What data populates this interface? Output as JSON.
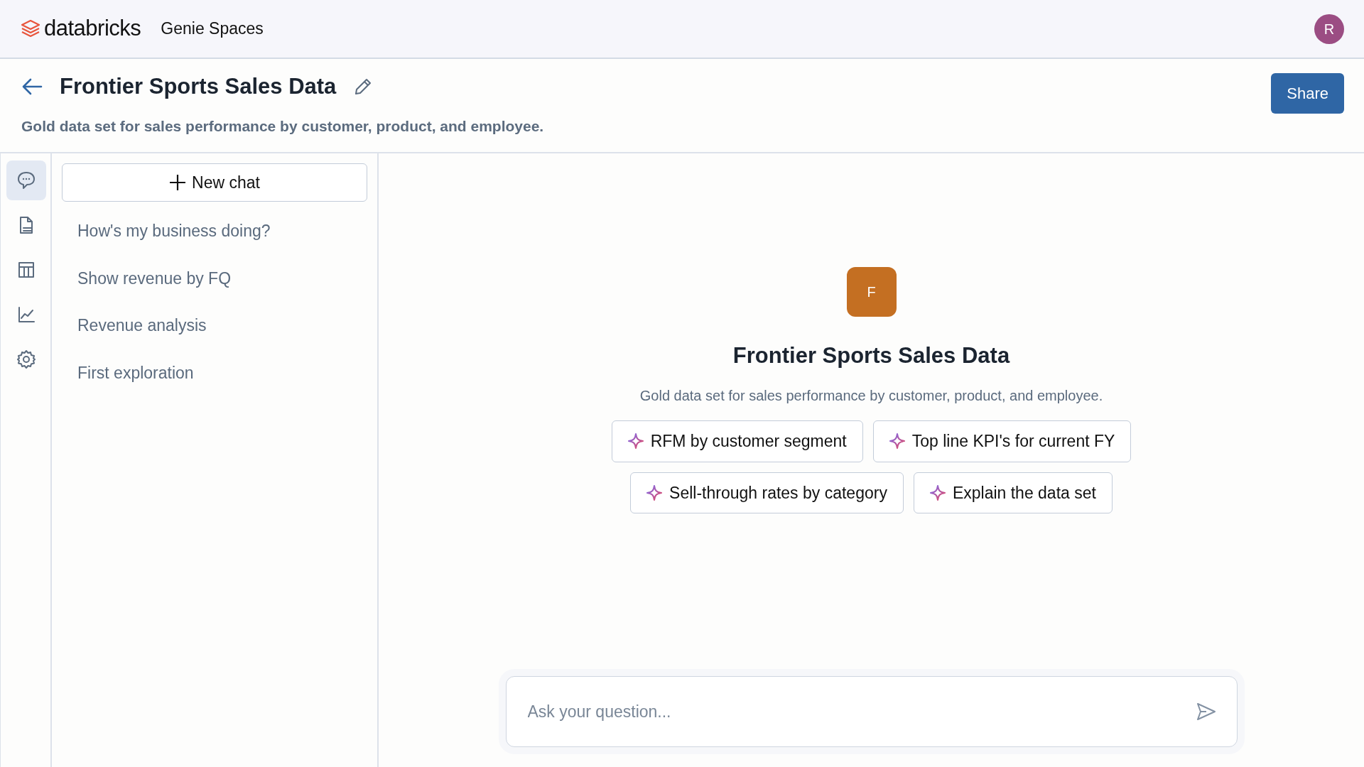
{
  "topbar": {
    "brand": "databricks",
    "product": "Genie Spaces",
    "avatar": "R"
  },
  "space": {
    "title": "Frontier Sports Sales Data",
    "description": "Gold data set for sales performance by customer, product, and employee.",
    "share": "Share"
  },
  "rail": [
    {
      "kind": "chat",
      "selected": true
    },
    {
      "kind": "document",
      "selected": false
    },
    {
      "kind": "table",
      "selected": false
    },
    {
      "kind": "chart",
      "selected": false
    },
    {
      "kind": "settings",
      "selected": false
    }
  ],
  "chats": {
    "new_chat": "New chat",
    "items": [
      "How's my business doing?",
      "Show revenue by FQ",
      "Revenue analysis",
      "First exploration"
    ]
  },
  "welcome": {
    "badge": "F",
    "title": "Frontier Sports Sales Data",
    "description": "Gold data set for sales performance by customer, product, and employee.",
    "suggestions": [
      "RFM by customer segment",
      "Top line KPI's for current FY",
      "Sell-through rates by category",
      "Explain the data set"
    ]
  },
  "composer": {
    "placeholder": "Ask your question..."
  }
}
